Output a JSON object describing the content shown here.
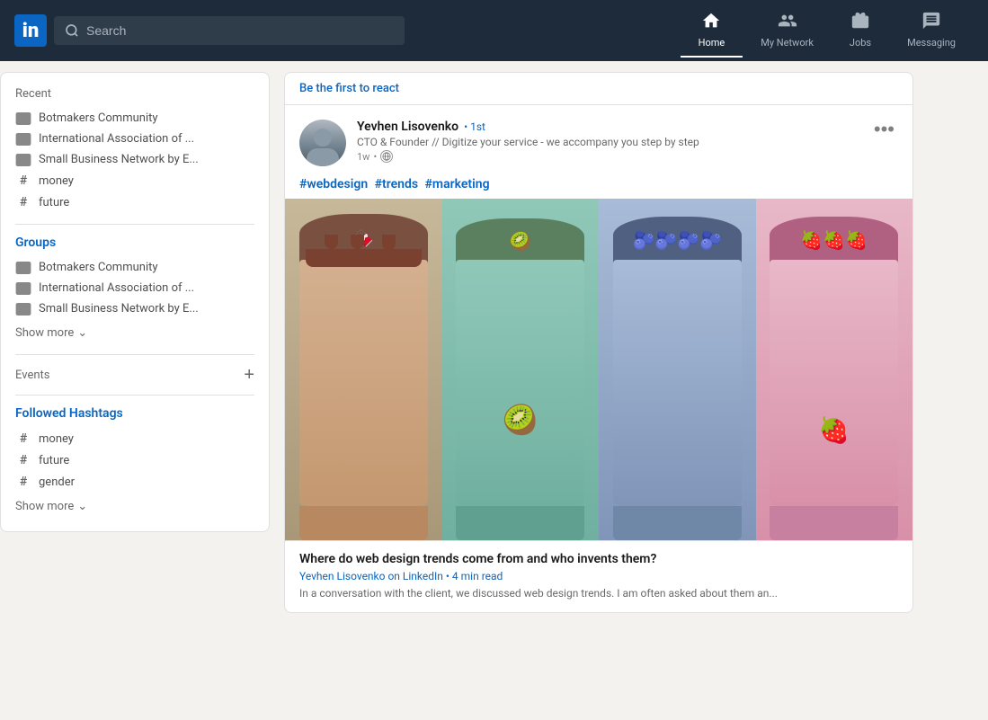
{
  "header": {
    "logo": "in",
    "search_placeholder": "Search",
    "nav": [
      {
        "id": "home",
        "label": "Home",
        "icon": "🏠",
        "active": true
      },
      {
        "id": "my-network",
        "label": "My Network",
        "icon": "👥",
        "active": false
      },
      {
        "id": "jobs",
        "label": "Jobs",
        "icon": "💼",
        "active": false
      },
      {
        "id": "messaging",
        "label": "Messaging",
        "icon": "💬",
        "active": false
      }
    ]
  },
  "sidebar": {
    "recent_label": "Recent",
    "recent_items": [
      {
        "id": "botmakers",
        "label": "Botmakers Community",
        "type": "group"
      },
      {
        "id": "intl-assoc",
        "label": "International Association of ...",
        "type": "group"
      },
      {
        "id": "small-biz",
        "label": "Small Business Network by E...",
        "type": "group"
      },
      {
        "id": "money-hash",
        "label": "money",
        "type": "hash"
      },
      {
        "id": "future-hash",
        "label": "future",
        "type": "hash"
      }
    ],
    "groups_label": "Groups",
    "group_items": [
      {
        "id": "botmakers-g",
        "label": "Botmakers Community",
        "type": "group"
      },
      {
        "id": "intl-assoc-g",
        "label": "International Association of ...",
        "type": "group"
      },
      {
        "id": "small-biz-g",
        "label": "Small Business Network by E...",
        "type": "group"
      }
    ],
    "show_more_label": "Show more",
    "events_label": "Events",
    "followed_hashtags_label": "Followed Hashtags",
    "hashtag_items": [
      {
        "id": "money-fh",
        "label": "money"
      },
      {
        "id": "future-fh",
        "label": "future"
      },
      {
        "id": "gender-fh",
        "label": "gender"
      }
    ],
    "show_more_2_label": "Show more"
  },
  "feed": {
    "first_react": {
      "prefix": "Be the ",
      "link": "first",
      "suffix": " to react"
    },
    "post": {
      "author_name": "Yevhen Lisovenko",
      "connection": "• 1st",
      "author_title": "CTO & Founder // Digitize your service - we accompany you step by step",
      "time": "1w",
      "hashtags": [
        "#webdesign",
        "#trends",
        "#marketing"
      ],
      "more_icon": "•••",
      "image_alt": "Colorful smoothie cups with fruit toppings",
      "article_title": "Where do web design trends come from and who invents them?",
      "article_source": "Yevhen Lisovenko on LinkedIn",
      "article_read_time": "4 min read",
      "article_excerpt_start": "In a conversation with the client, we discussed web design trends. I am often asked about them an..."
    }
  }
}
